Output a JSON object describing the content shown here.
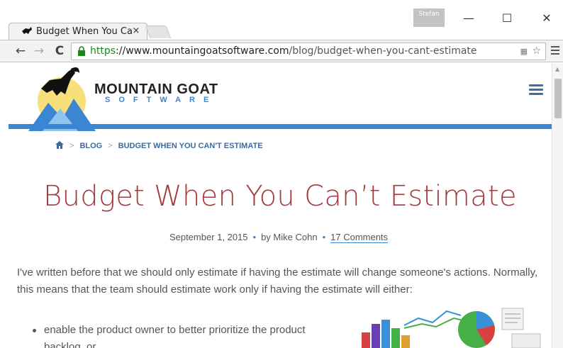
{
  "browser": {
    "tab_title": "Budget When You Ca",
    "tab_close": "×",
    "profile_name": "Stefan",
    "window_minimize": "—",
    "window_maximize": "☐",
    "window_close": "✕",
    "url_scheme": "https",
    "url_host": "://www.mountaingoatsoftware.com",
    "url_path": "/blog/budget-when-you-cant-estimate",
    "back_label": "←",
    "forward_label": "→",
    "reload_label": "C"
  },
  "site": {
    "logo_line1": "MOUNTAIN GOAT",
    "logo_line2": "SOFTWARE",
    "accent_color": "#3b86d3"
  },
  "breadcrumb": {
    "items": [
      "BLOG",
      "BUDGET WHEN YOU CAN'T ESTIMATE"
    ],
    "separator": ">"
  },
  "article": {
    "title": "Budget When You Can’t Estimate",
    "date": "September 1, 2015",
    "author": "by Mike Cohn",
    "comments": "17 Comments",
    "paragraph": "I've written before that we should only estimate if having the estimate will change someone's actions. Normally, this means that the team should estimate work only if having the estimate will either:",
    "bullets": [
      "enable the product owner to better prioritize the product backlog, or"
    ]
  }
}
